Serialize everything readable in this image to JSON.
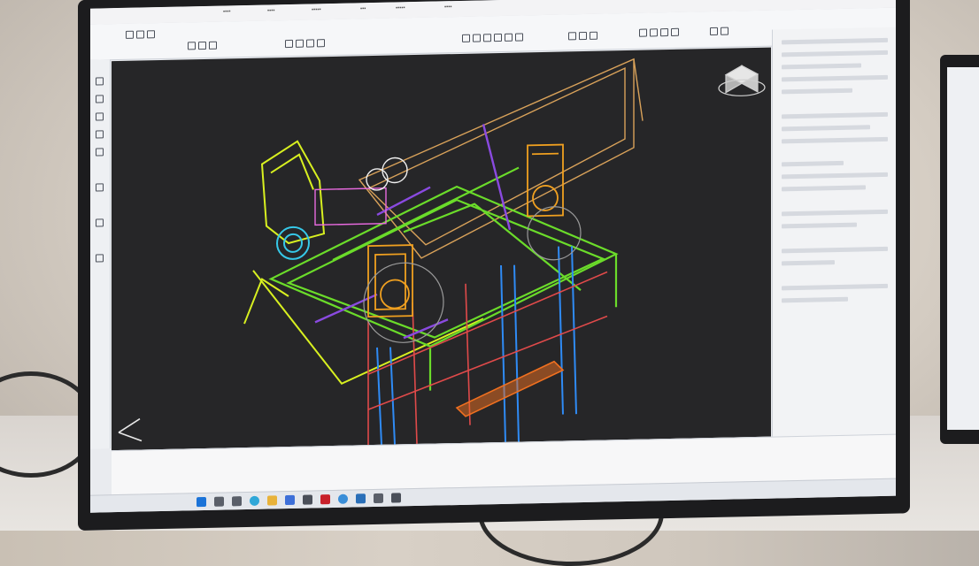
{
  "scene": {
    "description_label": "",
    "viewport_label": "",
    "command_line_text": "",
    "accent_colors": {
      "wire_yellow": "#d8f020",
      "wire_green": "#6bdc2a",
      "wire_orange": "#f0a020",
      "wire_blue": "#2f8bf5",
      "wire_red": "#e04a4a",
      "wire_purple": "#8a4ae0",
      "wire_cyan": "#36c8e8",
      "wire_tan": "#d9a25a",
      "viewport_bg": "#262628"
    }
  }
}
